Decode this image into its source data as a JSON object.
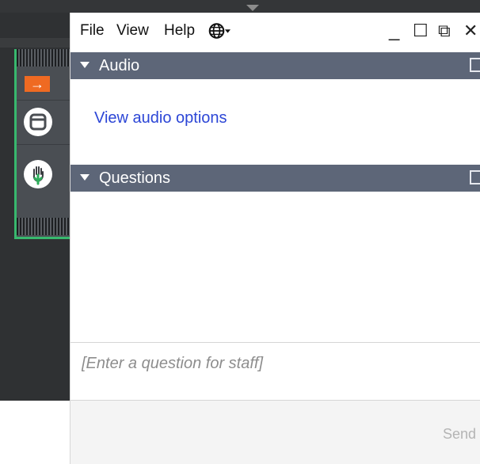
{
  "menubar": {
    "file": "File",
    "view": "View",
    "help": "Help"
  },
  "window_controls": {
    "minimize": "_",
    "maximize": "☐",
    "restore": "⧉",
    "close": "✕"
  },
  "sections": {
    "audio": {
      "title": "Audio",
      "link": "View audio options"
    },
    "questions": {
      "title": "Questions",
      "input_placeholder": "[Enter a question for staff]",
      "send_label": "Send"
    }
  },
  "control_panel": {
    "arrow_glyph": "→",
    "accent": "#38b86e",
    "arrow_color": "#ef6a22"
  },
  "colors": {
    "header_bg": "#5d6678",
    "link": "#2c46d6"
  }
}
